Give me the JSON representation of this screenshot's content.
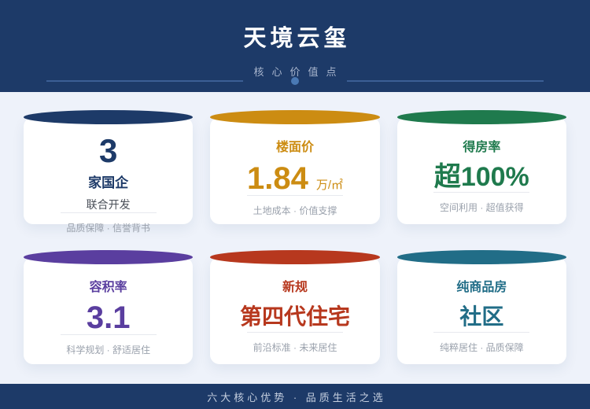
{
  "header": {
    "title": "天境云玺",
    "subtitle": "核心价值点"
  },
  "cards": [
    {
      "big": "3",
      "label": "家国企",
      "sub": "联合开发",
      "footer": "品质保障 · 信誉背书",
      "accent": "#1d3a68"
    },
    {
      "title": "楼面价",
      "value": "1.84",
      "unit": "万/㎡",
      "footer": "土地成本 · 价值支撑",
      "accent": "#cc8c12"
    },
    {
      "title": "得房率",
      "value": "超100%",
      "footer": "空间利用 · 超值获得",
      "accent": "#1f7a4d"
    },
    {
      "title": "容积率",
      "value": "3.1",
      "footer": "科学规划 · 舒适居住",
      "accent": "#5a3e9f"
    },
    {
      "title": "新规",
      "value": "第四代住宅",
      "footer": "前沿标准 · 未来居住",
      "accent": "#b7381e"
    },
    {
      "title": "纯商品房",
      "value": "社区",
      "footer": "纯粹居住 · 品质保障",
      "accent": "#216d87"
    }
  ],
  "footer": {
    "text": "六大核心优势 · 品质生活之选"
  }
}
